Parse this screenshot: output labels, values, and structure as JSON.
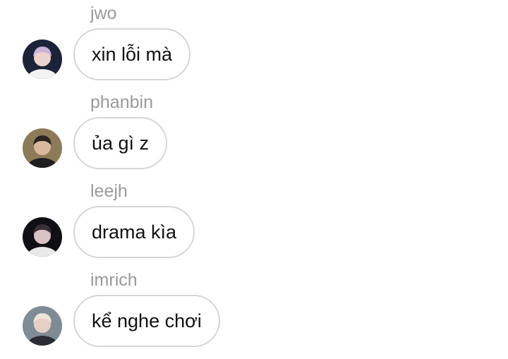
{
  "messages": [
    {
      "sender": "jwo",
      "text": "xin lỗi mà",
      "avatar_bg": "#1c2238",
      "avatar_hair": "#c9b3d8",
      "avatar_skin": "#e9d3cc",
      "avatar_shirt": "#f2f2f2"
    },
    {
      "sender": "phanbin",
      "text": "ủa gì z",
      "avatar_bg": "#8d7a58",
      "avatar_hair": "#2a2420",
      "avatar_skin": "#d9b8a0",
      "avatar_shirt": "#1f1f1f"
    },
    {
      "sender": "leejh",
      "text": "drama kìa",
      "avatar_bg": "#0f0f14",
      "avatar_hair": "#3a3038",
      "avatar_skin": "#d8c2c4",
      "avatar_shirt": "#e8e8e8"
    },
    {
      "sender": "imrich",
      "text": "kể nghe chơi",
      "avatar_bg": "#7f8c96",
      "avatar_hair": "#ece4da",
      "avatar_skin": "#e6cfc4",
      "avatar_shirt": "#2b2d33"
    }
  ]
}
